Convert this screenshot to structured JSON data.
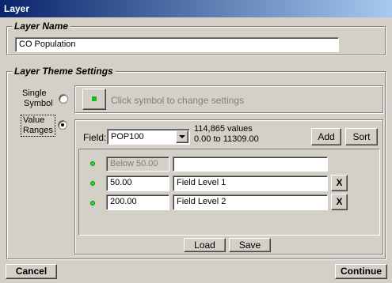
{
  "window": {
    "title": "Layer"
  },
  "layer_name": {
    "legend": "Layer Name",
    "value": "CO Population"
  },
  "theme": {
    "legend": "Layer Theme Settings",
    "single_symbol": {
      "label_line1": "Single",
      "label_line2": "Symbol",
      "hint": "Click symbol to change settings",
      "selected": false
    },
    "value_ranges": {
      "label_line1": "Value",
      "label_line2": "Ranges",
      "selected": true,
      "field_label": "Field:",
      "field_value": "POP100",
      "stats_count": "114,865 values",
      "stats_range": "0.00 to 11309.00",
      "add_label": "Add",
      "sort_label": "Sort",
      "rows": [
        {
          "value": "Below 50.00",
          "label": "",
          "editable": false,
          "color": "#2fd52f"
        },
        {
          "value": "50.00",
          "label": "Field Level 1",
          "editable": true,
          "remove": "X",
          "color": "#2fd52f"
        },
        {
          "value": "200.00",
          "label": "Field Level 2",
          "editable": true,
          "remove": "X",
          "color": "#2fd52f"
        }
      ],
      "load_label": "Load",
      "save_label": "Save"
    }
  },
  "footer": {
    "cancel_label": "Cancel",
    "continue_label": "Continue"
  }
}
